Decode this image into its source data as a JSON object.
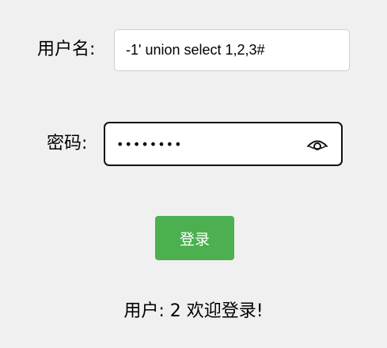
{
  "form": {
    "username_label": "用户名:",
    "username_value": "-1' union select 1,2,3#",
    "password_label": "密码:",
    "password_value": "12345678",
    "password_toggle_icon": "eye-icon",
    "login_button_label": "登录"
  },
  "result": {
    "welcome_message": "用户: 2 欢迎登录!"
  },
  "colors": {
    "background": "#f0f0f0",
    "button": "#4caf50",
    "button_text": "#ffffff"
  }
}
